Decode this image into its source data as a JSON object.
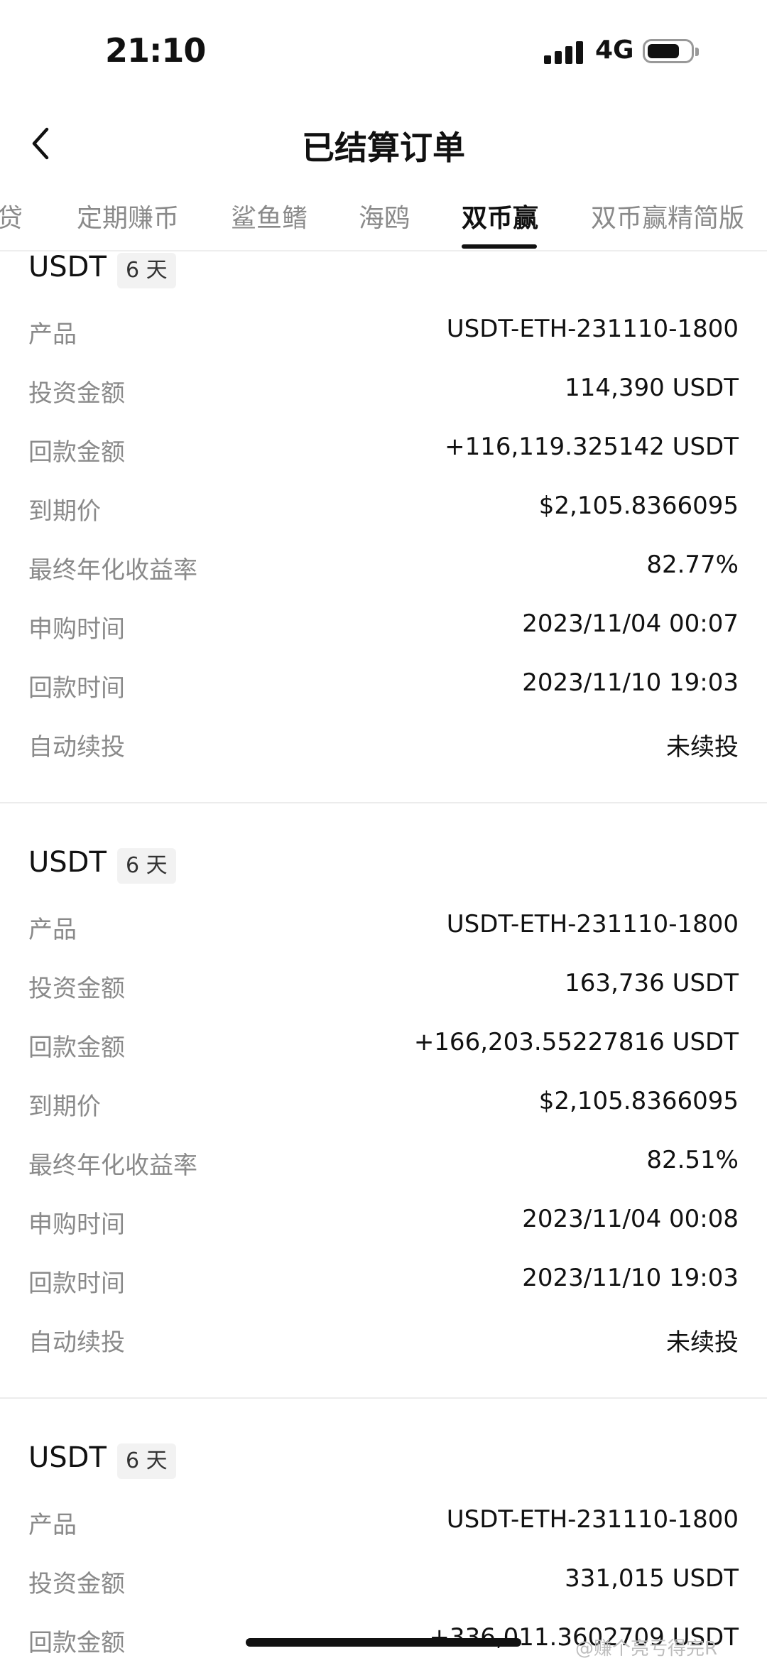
{
  "status_bar": {
    "time": "21:10",
    "network": "4G"
  },
  "header": {
    "title": "已结算订单"
  },
  "tabs": [
    {
      "label": "贷"
    },
    {
      "label": "定期赚币"
    },
    {
      "label": "鲨鱼鳍"
    },
    {
      "label": "海鸥"
    },
    {
      "label": "双币赢",
      "active": true
    },
    {
      "label": "双币赢精简版"
    }
  ],
  "orders": [
    {
      "coin": "USDT",
      "term": "6 天",
      "rows": [
        {
          "label": "产品",
          "value": "USDT-ETH-231110-1800"
        },
        {
          "label": "投资金额",
          "value": "114,390 USDT"
        },
        {
          "label": "回款金额",
          "value": "+116,119.325142 USDT"
        },
        {
          "label": "到期价",
          "value": "$2,105.8366095"
        },
        {
          "label": "最终年化收益率",
          "value": "82.77%"
        },
        {
          "label": "申购时间",
          "value": "2023/11/04 00:07"
        },
        {
          "label": "回款时间",
          "value": "2023/11/10 19:03"
        },
        {
          "label": "自动续投",
          "value": "未续投"
        }
      ]
    },
    {
      "coin": "USDT",
      "term": "6 天",
      "rows": [
        {
          "label": "产品",
          "value": "USDT-ETH-231110-1800"
        },
        {
          "label": "投资金额",
          "value": "163,736 USDT"
        },
        {
          "label": "回款金额",
          "value": "+166,203.55227816 USDT"
        },
        {
          "label": "到期价",
          "value": "$2,105.8366095"
        },
        {
          "label": "最终年化收益率",
          "value": "82.51%"
        },
        {
          "label": "申购时间",
          "value": "2023/11/04 00:08"
        },
        {
          "label": "回款时间",
          "value": "2023/11/10 19:03"
        },
        {
          "label": "自动续投",
          "value": "未续投"
        }
      ]
    },
    {
      "coin": "USDT",
      "term": "6 天",
      "rows": [
        {
          "label": "产品",
          "value": "USDT-ETH-231110-1800"
        },
        {
          "label": "投资金额",
          "value": "331,015 USDT"
        },
        {
          "label": "回款金额",
          "value": "+336,011.3602709 USDT"
        }
      ]
    }
  ],
  "watermark": "@赚个亮亏得完R"
}
